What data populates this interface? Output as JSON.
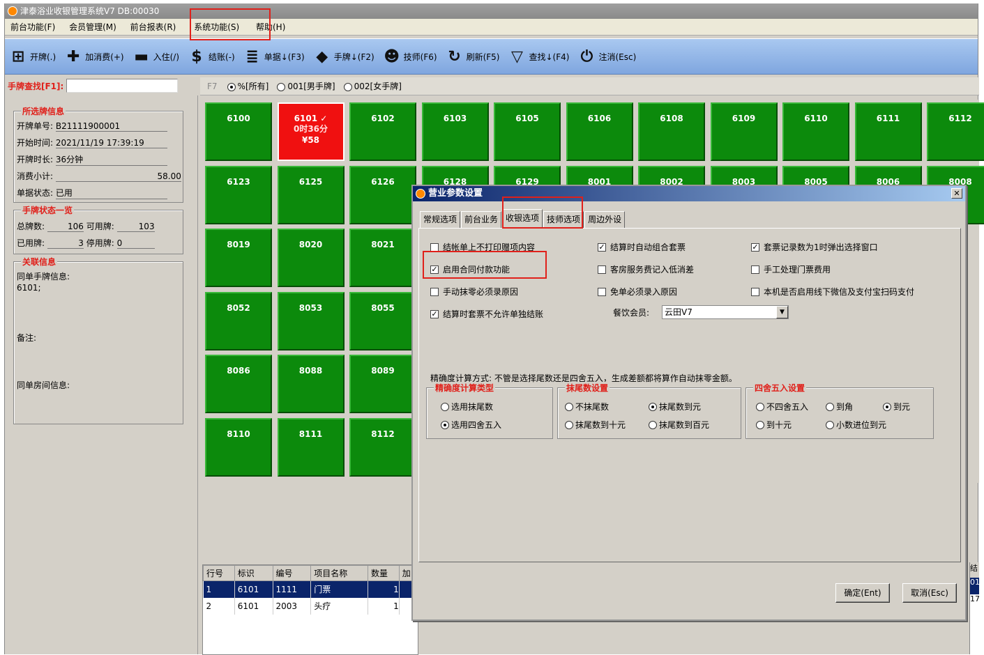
{
  "window": {
    "title": "津泰浴业收银管理系统V7  DB:00030"
  },
  "menu": [
    "前台功能(F)",
    "会员管理(M)",
    "前台报表(R)",
    "系统功能(S)",
    "帮助(H)"
  ],
  "toolbar": [
    {
      "icon": "plus-box-icon",
      "glyph": "⊞",
      "label": "开牌(.)"
    },
    {
      "icon": "plus-icon",
      "glyph": "✚",
      "label": "加消费(+)"
    },
    {
      "icon": "bed-icon",
      "glyph": "▬",
      "label": "入住(/)"
    },
    {
      "icon": "dollar-icon",
      "glyph": "$",
      "label": "结账(-)"
    },
    {
      "icon": "bill-icon",
      "glyph": "≣",
      "label": "单据↓(F3)"
    },
    {
      "icon": "tag-icon",
      "glyph": "◆",
      "label": "手牌↓(F2)"
    },
    {
      "icon": "technician-icon",
      "glyph": "☻",
      "label": "技师(F6)"
    },
    {
      "icon": "refresh-icon",
      "glyph": "↻",
      "label": "刷新(F5)"
    },
    {
      "icon": "filter-icon",
      "glyph": "▽",
      "label": "查找↓(F4)"
    },
    {
      "icon": "power-icon",
      "glyph": "⏻",
      "label": "注消(Esc)"
    }
  ],
  "search": {
    "label": "手牌查找[F1]:",
    "value": ""
  },
  "filter": {
    "key": "F7",
    "options": [
      "%[所有]",
      "001[男手牌]",
      "002[女手牌]"
    ],
    "selected": 0
  },
  "selected_card": {
    "title": "所选牌信息",
    "rows": [
      {
        "label": "开牌单号:",
        "value": "B21111900001"
      },
      {
        "label": "开始时间:",
        "value": "2021/11/19 17:39:19"
      },
      {
        "label": "开牌时长:",
        "value": "36分钟"
      },
      {
        "label": "消费小计:",
        "value": "58.00"
      },
      {
        "label": "单据状态:",
        "value": "已用"
      }
    ]
  },
  "card_status": {
    "title": "手牌状态一览",
    "total_label": "总牌数:",
    "total": "106",
    "avail_label": "可用牌:",
    "avail": "103",
    "used_label": "已用牌:",
    "used": "3",
    "stopped_label": "停用牌:",
    "stopped": "0"
  },
  "related": {
    "title": "关联信息",
    "same_bill_label": "同单手牌信息:",
    "same_bill_value": "6101;",
    "note_label": "备注:",
    "room_label": "同单房间信息:"
  },
  "tiles": [
    [
      "6100",
      "6101",
      "6102",
      "6103",
      "6105",
      "6106",
      "6108",
      "6109",
      "6110",
      "6111",
      "6112"
    ],
    [
      "6123",
      "6125",
      "6126",
      "6128",
      "6129",
      "8001",
      "8002",
      "8003",
      "8005",
      "8006",
      "8008"
    ],
    [
      "8019",
      "8020",
      "8021"
    ],
    [
      "8052",
      "8053",
      "8055"
    ],
    [
      "8086",
      "8088",
      "8089"
    ],
    [
      "8110",
      "8111",
      "8112"
    ]
  ],
  "active_tile": {
    "number": "6101",
    "mark": "✓",
    "duration": "0时36分",
    "amount": "¥58"
  },
  "bill_table": {
    "headers": [
      "行号",
      "标识",
      "编号",
      "项目名称",
      "数量",
      "加"
    ],
    "rows": [
      [
        "1",
        "6101",
        "1111",
        "门票",
        "1"
      ],
      [
        "2",
        "6101",
        "2003",
        "头疗",
        "1"
      ]
    ]
  },
  "dialog": {
    "title": "营业参数设置",
    "close": "✕",
    "tabs": [
      "常规选项",
      "前台业务",
      "收银选项",
      "技师选项",
      "周边外设"
    ],
    "active_tab": 2,
    "options": [
      {
        "label": "结帐单上不打印赠项内容",
        "checked": false
      },
      {
        "label": "结算时自动组合套票",
        "checked": true
      },
      {
        "label": "套票记录数为1时弹出选择窗口",
        "checked": true
      },
      {
        "label": "启用合同付款功能",
        "checked": true
      },
      {
        "label": "客房服务费记入低消差",
        "checked": false
      },
      {
        "label": "手工处理门票费用",
        "checked": false
      },
      {
        "label": "手动抹零必须录原因",
        "checked": false
      },
      {
        "label": "免单必须录入原因",
        "checked": false
      },
      {
        "label": "本机是否启用线下微信及支付宝扫码支付",
        "checked": false
      },
      {
        "label": "结算时套票不允许单独结账",
        "checked": true
      }
    ],
    "member_label": "餐饮会员:",
    "member_value": "云田V7",
    "precision_note": "精确度计算方式: 不管是选择尾数还是四舍五入，生成差额都将算作自动抹零金额。",
    "group1": {
      "title": "精确度计算类型",
      "options": [
        "选用抹尾数",
        "选用四舍五入"
      ],
      "selected": 1
    },
    "group2": {
      "title": "抹尾数设置",
      "options": [
        "不抹尾数",
        "抹尾数到元",
        "抹尾数到十元",
        "抹尾数到百元"
      ],
      "selected": 1
    },
    "group3": {
      "title": "四舍五入设置",
      "options": [
        "不四舍五入",
        "到角",
        "到元",
        "到十元",
        "小数进位到元"
      ],
      "selected": 2
    },
    "ok": "确定(Ent)",
    "cancel": "取消(Esc)"
  },
  "right_edge": [
    "结",
    "01",
    "17"
  ]
}
